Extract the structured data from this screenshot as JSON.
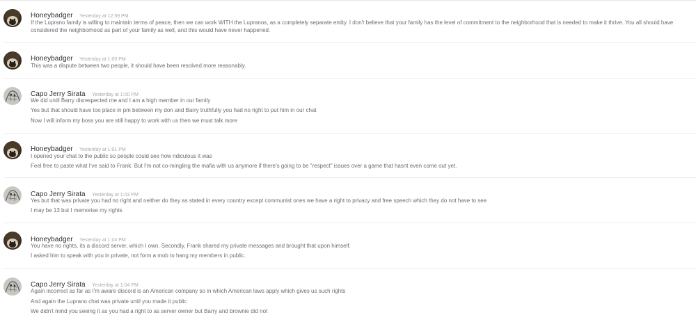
{
  "messages": [
    {
      "username": "Honeybadger",
      "timestamp": "Yesterday at 12:59 PM",
      "avatar_icon": "badger-avatar-icon",
      "lines": [
        "If the Luprano family is willing to maintain terms of peace, then we can work WITH the Lupranos, as a completely separate entity. I don't believe that your family has the level of commitment to the neighborhood that is needed to make it thrive. You all should have considered the neighborhood as part of your family as well, and this would have never happened."
      ]
    },
    {
      "username": "Honeybadger",
      "timestamp": "Yesterday at 1:00 PM",
      "avatar_icon": "badger-avatar-icon",
      "lines": [
        "This was a dispute between two people, it should have been resolved more reasonably."
      ]
    },
    {
      "username": "Capo Jerry Sirata",
      "timestamp": "Yesterday at 1:00 PM",
      "avatar_icon": "sketch-avatar-icon",
      "lines": [
        "We did until Barry disrespected me and I am a high member in our family",
        "Yes but that should have too place in pm between my don and Barry truthfully you had no right to put him in our chat",
        "Now I will inform my boss you are still happy to work with us then we must talk more"
      ]
    },
    {
      "username": "Honeybadger",
      "timestamp": "Yesterday at 1:01 PM",
      "avatar_icon": "badger-avatar-icon",
      "lines": [
        "I opened your chat to the public so people could see how ridiculous it was",
        "Feel free to paste what I've said to Frank. But I'm not co-mingling the mafia with us anymore if there's going to be \"respect\" issues over a game that hasnt even come out yet."
      ]
    },
    {
      "username": "Capo Jerry Sirata",
      "timestamp": "Yesterday at 1:03 PM",
      "avatar_icon": "sketch-avatar-icon",
      "lines": [
        "Yes but that was private you had no right and neither do they as stated in every country except communist ones we have a right to privacy and free speech which they do not have to see",
        "I may be 13 but I memorise my rights"
      ]
    },
    {
      "username": "Honeybadger",
      "timestamp": "Yesterday at 1:04 PM",
      "avatar_icon": "badger-avatar-icon",
      "lines": [
        "You have no rights, its a discord server, which I own. Secondly, Frank shared my private messages and brought that upon himself.",
        "I asked him to speak with you in private, not form a mob to hang my members in public."
      ]
    },
    {
      "username": "Capo Jerry Sirata",
      "timestamp": "Yesterday at 1:04 PM",
      "avatar_icon": "sketch-avatar-icon",
      "lines": [
        "Again incorrect as far as I'm aware discord is an American company so in which American laws apply which gives us such rights",
        "And again the Luprano chat was private until you made it public",
        "We didn't mind you seeing it as you had a right to as server owner but Barry and brownie did not"
      ]
    }
  ]
}
